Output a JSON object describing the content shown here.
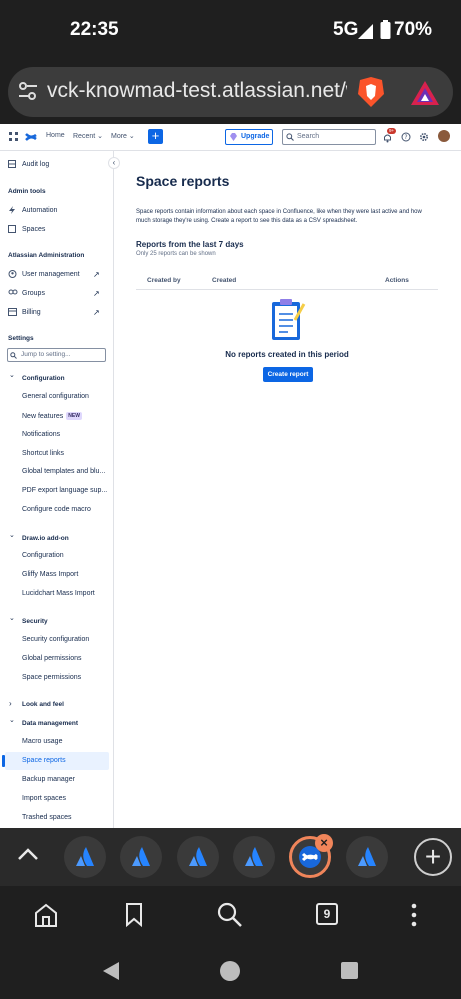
{
  "status": {
    "time": "22:35",
    "network": "5G",
    "battery": "70%"
  },
  "browser": {
    "url": "vck-knowmad-test.atlassian.net/wik",
    "tab_count": "9"
  },
  "topnav": {
    "home": "Home",
    "recent": "Recent",
    "more": "More",
    "upgrade": "Upgrade",
    "search_placeholder": "Search",
    "notif_count": "9+"
  },
  "sidebar": {
    "audit_log": "Audit log",
    "admin_tools": "Admin tools",
    "automation": "Automation",
    "spaces": "Spaces",
    "atl_admin": "Atlassian Administration",
    "user_management": "User management",
    "groups": "Groups",
    "billing": "Billing",
    "settings": "Settings",
    "jump_placeholder": "Jump to setting...",
    "configuration": "Configuration",
    "general_configuration": "General configuration",
    "new_features": "New features",
    "new_badge": "NEW",
    "notifications": "Notifications",
    "shortcut_links": "Shortcut links",
    "global_templates": "Global templates and blu...",
    "pdf_export": "PDF export language sup...",
    "configure_code_macro": "Configure code macro",
    "drawio_addon": "Draw.io add-on",
    "drawio_configuration": "Configuration",
    "gliffy": "Gliffy Mass Import",
    "lucidchart": "Lucidchart Mass Import",
    "security": "Security",
    "security_configuration": "Security configuration",
    "global_permissions": "Global permissions",
    "space_permissions": "Space permissions",
    "look_and_feel": "Look and feel",
    "data_management": "Data management",
    "macro_usage": "Macro usage",
    "space_reports": "Space reports",
    "backup_manager": "Backup manager",
    "import_spaces": "Import spaces",
    "trashed_spaces": "Trashed spaces"
  },
  "main": {
    "title": "Space reports",
    "description": "Space reports contain information about each space in Confluence, like when they were last active and how much storage they're using. Create a report to see this data as a CSV spreadsheet.",
    "section_title": "Reports from the last 7 days",
    "section_sub": "Only 25 reports can be shown",
    "col_created_by": "Created by",
    "col_created": "Created",
    "col_actions": "Actions",
    "empty_text": "No reports created in this period",
    "create_button": "Create report"
  },
  "colors": {
    "accent": "#0c66e4",
    "selected_bg": "#e9f2ff"
  }
}
